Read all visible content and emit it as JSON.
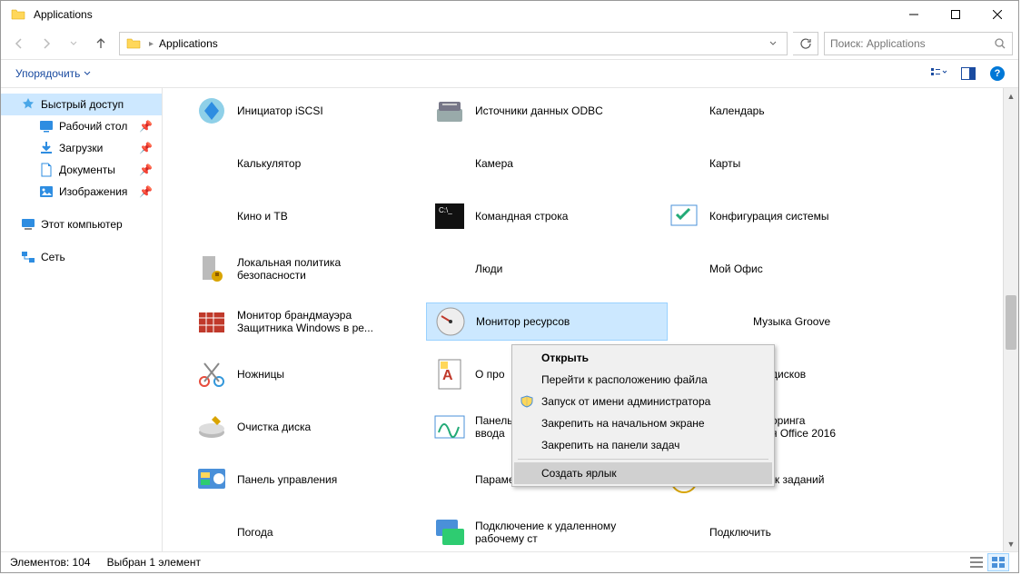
{
  "window": {
    "title": "Applications"
  },
  "breadcrumb": {
    "crumb1": "Applications"
  },
  "search": {
    "placeholder": "Поиск: Applications"
  },
  "toolbar": {
    "organize": "Упорядочить"
  },
  "sidebar": {
    "quick_access": "Быстрый доступ",
    "desktop": "Рабочий стол",
    "downloads": "Загрузки",
    "documents": "Документы",
    "pictures": "Изображения",
    "this_pc": "Этот компьютер",
    "network": "Сеть"
  },
  "items": {
    "r0c0": "Инициатор iSCSI",
    "r0c1": "Источники данных ODBC",
    "r0c2": "Календарь",
    "r1c0": "Калькулятор",
    "r1c1": "Камера",
    "r1c2": "Карты",
    "r2c0": "Кино и ТВ",
    "r2c1": "Командная строка",
    "r2c2": "Конфигурация системы",
    "r3c0": "Локальная политика безопасности",
    "r3c1": "Люди",
    "r3c2": "Мой Офис",
    "r4c0": "Монитор брандмауэра Защитника Windows в ре...",
    "r4c1": "Монитор ресурсов",
    "r4c2": "Музыка Groove",
    "r5c0": "Ножницы",
    "r5c1": "О про",
    "r5c2": "дисков",
    "r6c0": "Очистка диска",
    "r6c1a": "Панель",
    "r6c1b": "ввода",
    "r6c2a": "оринга",
    "r6c2b": "я Office 2016",
    "r7c0": "Панель управления",
    "r7c1": "Параметры",
    "r7c2": "Планировщик заданий",
    "r8c0": "Погода",
    "r8c1": "Подключение к удаленному рабочему ст",
    "r8c2": "Подключить"
  },
  "context_menu": {
    "open": "Открыть",
    "goto_file": "Перейти к расположению файла",
    "run_admin": "Запуск от имени администратора",
    "pin_start": "Закрепить на начальном экране",
    "pin_taskbar": "Закрепить на панели задач",
    "create_shortcut": "Создать ярлык"
  },
  "status": {
    "elements": "Элементов: 104",
    "selected": "Выбран 1 элемент"
  }
}
